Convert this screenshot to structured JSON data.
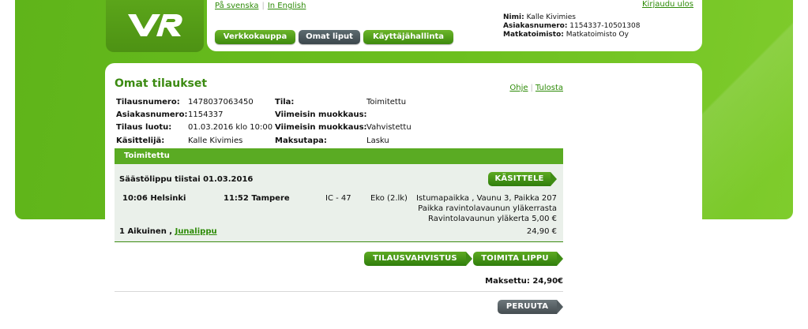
{
  "header": {
    "lang_sv": "På svenska",
    "lang_en": "In English",
    "logout": "Kirjaudu ulos",
    "nav": [
      "Verkkokauppa",
      "Omat liput",
      "Käyttäjähallinta"
    ],
    "user": {
      "name_label": "Nimi:",
      "name": "Kalle Kivimies",
      "customer_label": "Asiakasnumero:",
      "customer": "1154337-10501308",
      "agency_label": "Matkatoimisto:",
      "agency": "Matkatoimisto Oy"
    }
  },
  "page": {
    "title": "Omat tilaukset",
    "help": "Ohje",
    "print": "Tulosta"
  },
  "order": {
    "order_no_label": "Tilausnumero:",
    "order_no": "1478037063450",
    "customer_label": "Asiakasnumero:",
    "customer": "1154337",
    "created_label": "Tilaus luotu:",
    "created": "01.03.2016 klo 10:00",
    "handler_label": "Käsittelijä:",
    "handler": "Kalle Kivimies",
    "status_label": "Tila:",
    "status": "Toimitettu",
    "modified1_label": "Viimeisin muokkaus:",
    "modified1": "",
    "modified2_label": "Viimeisin muokkaus:",
    "modified2": "Vahvistettu",
    "payment_label": "Maksutapa:",
    "payment": "Lasku"
  },
  "delivered": {
    "header": "Toimitettu",
    "ticket_title": "Säästölippu tiistai 01.03.2016",
    "process_button": "KÄSITTELE",
    "departure": "10:06 Helsinki",
    "arrival": "11:52 Tampere",
    "train": "IC - 47",
    "class": "Eko (2.lk)",
    "seat": "Istumapaikka , Vaunu 3, Paikka 207",
    "seat_note": "Paikka ravintolavaunun yläkerrasta",
    "extra": "Ravintolavaunun yläkerta 5,00 €",
    "passengers": "1 Aikuinen ,",
    "ticket_type": "Junalippu",
    "price": "24,90 €"
  },
  "actions": {
    "confirmation": "TILAUSVAHVISTUS",
    "deliver": "TOIMITA LIPPU",
    "paid": "Maksettu: 24,90€",
    "cancel": "PERUUTA"
  },
  "colors": {
    "brand_green": "#6cbf1f",
    "dark_green": "#3c8b12",
    "gray_button": "#4a5458",
    "section_bg": "#eaf0ea"
  }
}
